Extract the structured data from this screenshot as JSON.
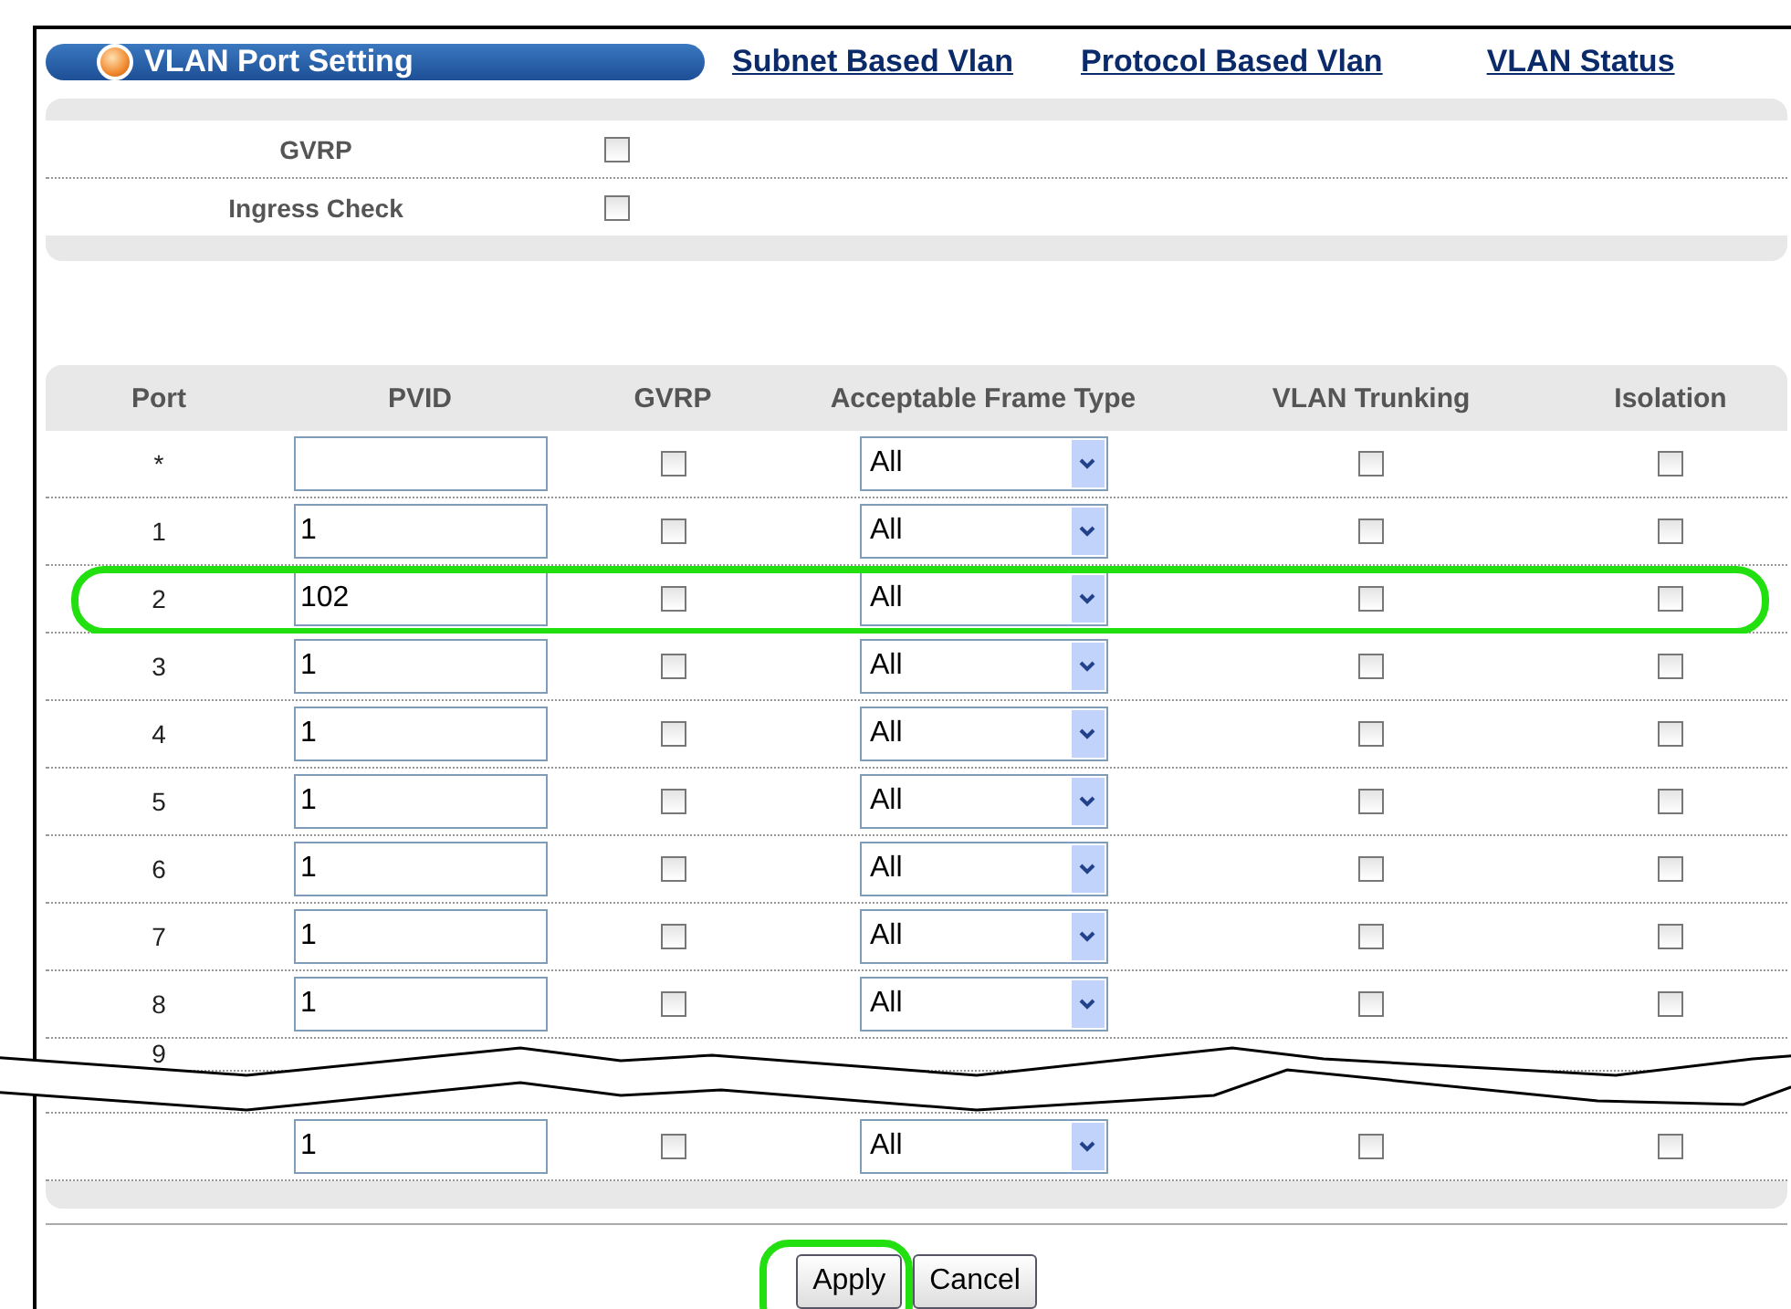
{
  "header": {
    "title": "VLAN Port Setting",
    "links": [
      "Subnet Based Vlan",
      "Protocol Based Vlan",
      "VLAN Status"
    ]
  },
  "global_settings": [
    {
      "label": "GVRP",
      "checked": false
    },
    {
      "label": "Ingress Check",
      "checked": false
    }
  ],
  "table": {
    "columns": [
      "Port",
      "PVID",
      "GVRP",
      "Acceptable Frame Type",
      "VLAN Trunking",
      "Isolation"
    ],
    "rows": [
      {
        "kind": "full",
        "port": "*",
        "pvid": "",
        "gvrp": false,
        "frame_type": "All",
        "trunking": false,
        "isolation": false,
        "highlighted": false
      },
      {
        "kind": "full",
        "port": "1",
        "pvid": "1",
        "gvrp": false,
        "frame_type": "All",
        "trunking": false,
        "isolation": false,
        "highlighted": false
      },
      {
        "kind": "full",
        "port": "2",
        "pvid": "102",
        "gvrp": false,
        "frame_type": "All",
        "trunking": false,
        "isolation": false,
        "highlighted": true
      },
      {
        "kind": "full",
        "port": "3",
        "pvid": "1",
        "gvrp": false,
        "frame_type": "All",
        "trunking": false,
        "isolation": false,
        "highlighted": false
      },
      {
        "kind": "full",
        "port": "4",
        "pvid": "1",
        "gvrp": false,
        "frame_type": "All",
        "trunking": false,
        "isolation": false,
        "highlighted": false
      },
      {
        "kind": "full",
        "port": "5",
        "pvid": "1",
        "gvrp": false,
        "frame_type": "All",
        "trunking": false,
        "isolation": false,
        "highlighted": false
      },
      {
        "kind": "full",
        "port": "6",
        "pvid": "1",
        "gvrp": false,
        "frame_type": "All",
        "trunking": false,
        "isolation": false,
        "highlighted": false
      },
      {
        "kind": "full",
        "port": "7",
        "pvid": "1",
        "gvrp": false,
        "frame_type": "All",
        "trunking": false,
        "isolation": false,
        "highlighted": false
      },
      {
        "kind": "full",
        "port": "8",
        "pvid": "1",
        "gvrp": false,
        "frame_type": "All",
        "trunking": false,
        "isolation": false,
        "highlighted": false
      },
      {
        "kind": "partial",
        "port": "9"
      },
      {
        "kind": "break"
      },
      {
        "kind": "full",
        "port": "",
        "pvid": "1",
        "gvrp": false,
        "frame_type": "All",
        "trunking": false,
        "isolation": false,
        "highlighted": false
      }
    ]
  },
  "buttons": [
    {
      "label": "Apply",
      "highlighted": true
    },
    {
      "label": "Cancel",
      "highlighted": false
    }
  ]
}
